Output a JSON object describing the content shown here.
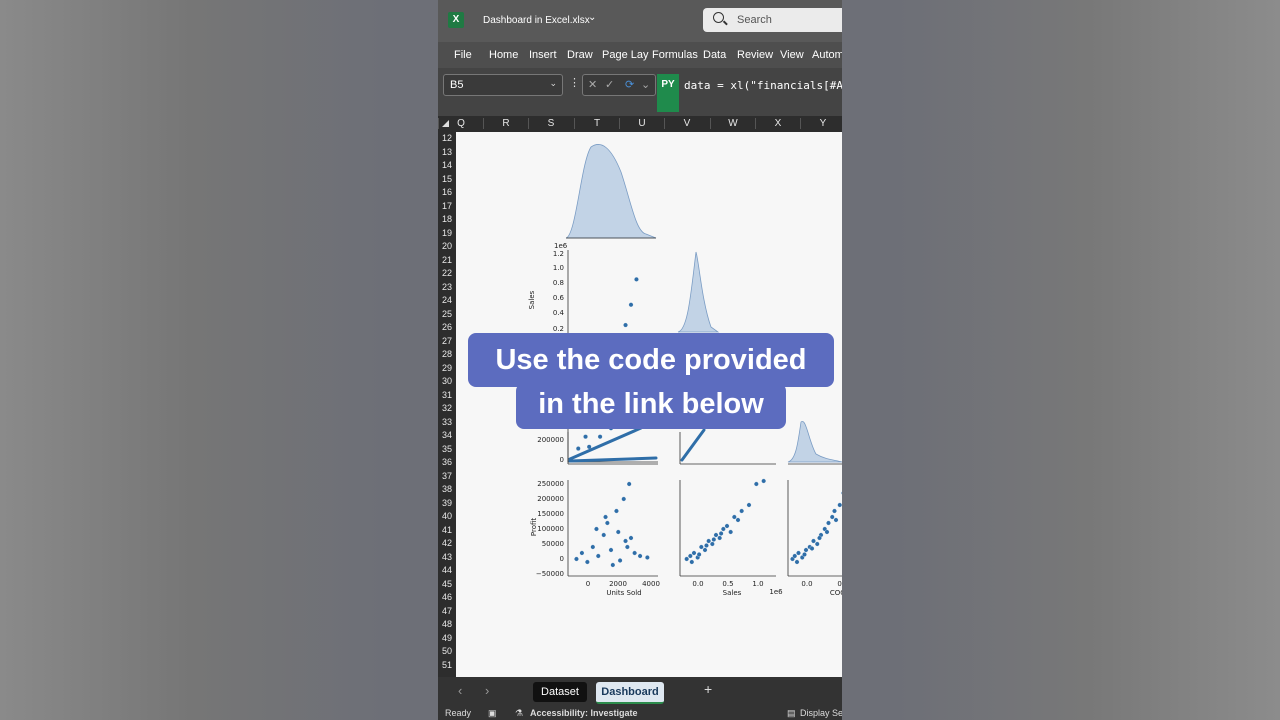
{
  "app": {
    "logo": "X",
    "document_title": "Dashboard in Excel.xlsx",
    "search_placeholder": "Search"
  },
  "menu": [
    "File",
    "Home",
    "Insert",
    "Draw",
    "Page Lay",
    "Formulas",
    "Data",
    "Review",
    "View",
    "Autom"
  ],
  "formula_bar": {
    "name_box": "B5",
    "python_badge": "PY",
    "formula": "data = xl(\"financials[#A"
  },
  "columns": [
    "Q",
    "R",
    "S",
    "T",
    "U",
    "V",
    "W",
    "X",
    "Y"
  ],
  "rows": [
    "12",
    "13",
    "14",
    "15",
    "16",
    "17",
    "18",
    "19",
    "20",
    "21",
    "22",
    "23",
    "24",
    "25",
    "26",
    "27",
    "28",
    "29",
    "30",
    "31",
    "32",
    "33",
    "34",
    "35",
    "36",
    "37",
    "38",
    "39",
    "40",
    "41",
    "42",
    "43",
    "44",
    "45",
    "46",
    "47",
    "48",
    "49",
    "50",
    "51"
  ],
  "overlay": {
    "line1": "Use the code provided",
    "line2": "in the link below"
  },
  "tabs": {
    "dataset": "Dataset",
    "dashboard": "Dashboard",
    "add": "+"
  },
  "status": {
    "ready": "Ready",
    "accessibility": "Accessibility: Investigate",
    "display": "Display Se"
  },
  "colors": {
    "excel_green": "#1f7a43",
    "overlay_bg": "#5c6cbf",
    "kde_fill": "#c2d3e6",
    "point": "#2f6ea8"
  },
  "chart_data": {
    "type": "scatter",
    "variables": [
      "Units Sold",
      "Sales",
      "COGS",
      "Profit"
    ],
    "axis_labels": {
      "sales_y": "Sales",
      "profit_y": "Profit",
      "units_x": "Units Sold",
      "sales_x": "Sales",
      "cogs_x": "COGS",
      "sales_offset": "1e6"
    },
    "ticks": {
      "sales_y": [
        "1.2",
        "1.0",
        "0.8",
        "0.6",
        "0.4",
        "0.2"
      ],
      "cogs_y": [
        "200000",
        "0"
      ],
      "profit_y": [
        "250000",
        "200000",
        "150000",
        "100000",
        "50000",
        "0",
        "−50000"
      ],
      "units_x": [
        "0",
        "2000",
        "4000"
      ],
      "sales_x": [
        "0.0",
        "0.5",
        "1.0"
      ],
      "cogs_x": [
        "0.0",
        "0.5"
      ]
    },
    "sales_vs_units": {
      "x": [
        400,
        800,
        1200,
        1500,
        1800,
        2100,
        2400,
        2700,
        3000,
        3300,
        3600,
        1000,
        1600,
        2200,
        2800,
        3400,
        4000
      ],
      "y": [
        0.05,
        0.12,
        0.22,
        0.3,
        0.38,
        0.47,
        0.57,
        0.67,
        0.78,
        0.9,
        1.05,
        0.06,
        0.12,
        0.17,
        0.22,
        0.28,
        0.5
      ]
    },
    "profit_vs_units": {
      "x": [
        300,
        600,
        900,
        1200,
        1500,
        1800,
        2000,
        2200,
        2500,
        2700,
        3000,
        3200,
        3500,
        3800,
        4200,
        1400,
        1900,
        2300,
        2600,
        2900,
        3100,
        3300
      ],
      "y": [
        0,
        20000,
        -10000,
        40000,
        10000,
        80000,
        120000,
        30000,
        160000,
        -5000,
        60000,
        250000,
        20000,
        10000,
        5000,
        100000,
        140000,
        -20000,
        90000,
        200000,
        40000,
        70000
      ]
    },
    "profit_vs_sales": {
      "x": [
        0.05,
        0.1,
        0.15,
        0.2,
        0.25,
        0.3,
        0.35,
        0.4,
        0.45,
        0.5,
        0.55,
        0.6,
        0.65,
        0.7,
        0.75,
        0.8,
        0.9,
        1.0,
        1.1,
        0.12,
        0.22,
        0.32,
        0.42,
        0.52
      ],
      "y": [
        0,
        10000,
        20000,
        5000,
        40000,
        30000,
        60000,
        50000,
        80000,
        70000,
        100000,
        110000,
        90000,
        140000,
        130000,
        160000,
        180000,
        250000,
        260000,
        -10000,
        15000,
        45000,
        65000,
        85000
      ]
    },
    "profit_vs_cogs": {
      "x": [
        0.02,
        0.05,
        0.1,
        0.15,
        0.2,
        0.25,
        0.3,
        0.35,
        0.4,
        0.45,
        0.5,
        0.55,
        0.6,
        0.65,
        0.7,
        0.08,
        0.18,
        0.28,
        0.38,
        0.48,
        0.58
      ],
      "y": [
        0,
        10000,
        20000,
        5000,
        30000,
        40000,
        60000,
        50000,
        80000,
        100000,
        120000,
        140000,
        130000,
        180000,
        220000,
        -10000,
        15000,
        35000,
        70000,
        90000,
        160000
      ]
    },
    "sales_vs_cogs": {
      "x": [
        0.02,
        0.05,
        0.1,
        0.15,
        0.2,
        0.25,
        0.3,
        0.35
      ],
      "y": [
        0.05,
        0.1,
        0.15,
        0.2,
        0.27,
        0.33,
        0.39,
        0.45
      ]
    }
  }
}
